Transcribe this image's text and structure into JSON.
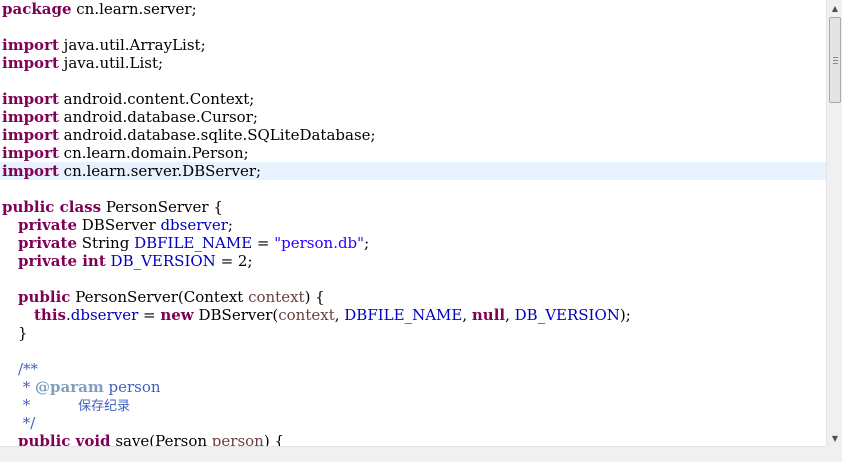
{
  "code": {
    "l1": {
      "kw": "package",
      "text": " cn.learn.server;"
    },
    "l3": {
      "kw": "import",
      "text": " java.util.ArrayList;"
    },
    "l4": {
      "kw": "import",
      "text": " java.util.List;"
    },
    "l6": {
      "kw": "import",
      "text": " android.content.Context;"
    },
    "l7": {
      "kw": "import",
      "text": " android.database.Cursor;"
    },
    "l8": {
      "kw": "import",
      "text": " android.database.sqlite.SQLiteDatabase;"
    },
    "l9": {
      "kw": "import",
      "text": " cn.learn.domain.Person;"
    },
    "l10": {
      "kw": "import",
      "text": " cn.learn.server.DBServer;"
    },
    "l12": {
      "kw": "public class",
      "text": " PersonServer {"
    },
    "l13": {
      "kw": "private",
      "type": " DBServer ",
      "field": "dbserver",
      "end": ";"
    },
    "l14": {
      "kw": "private",
      "type": " String ",
      "field": "DBFILE_NAME",
      "eq": " = ",
      "str": "\"person.db\"",
      "end": ";"
    },
    "l15": {
      "kw": "private int",
      "sp": " ",
      "field": "DB_VERSION",
      "end": " = 2;"
    },
    "l17": {
      "kw": "public",
      "text": " PersonServer(Context ",
      "param": "context",
      "end": ") {"
    },
    "l18": {
      "kw_this": "this",
      "dot": ".",
      "field": "dbserver",
      "eq": " = ",
      "kw_new": "new",
      "call": " DBServer(",
      "param": "context",
      "comma1": ", ",
      "field2": "DBFILE_NAME",
      "comma2": ", ",
      "kw_null": "null",
      "comma3": ", ",
      "field3": "DB_VERSION",
      "end": ");"
    },
    "l19": {
      "text": "}"
    },
    "l21": {
      "text": "/**"
    },
    "l22": {
      "star": " * ",
      "tag": "@param",
      "rest": " person"
    },
    "l23": {
      "star": " *",
      "gap": "          ",
      "cjk": "保存纪录"
    },
    "l24": {
      "text": " */"
    },
    "l25": {
      "kw": "public void",
      "text": " save(Person ",
      "param": "person",
      "end": ") {"
    }
  },
  "scrollbar": {
    "up_icon": "▲",
    "down_icon": "▼"
  }
}
